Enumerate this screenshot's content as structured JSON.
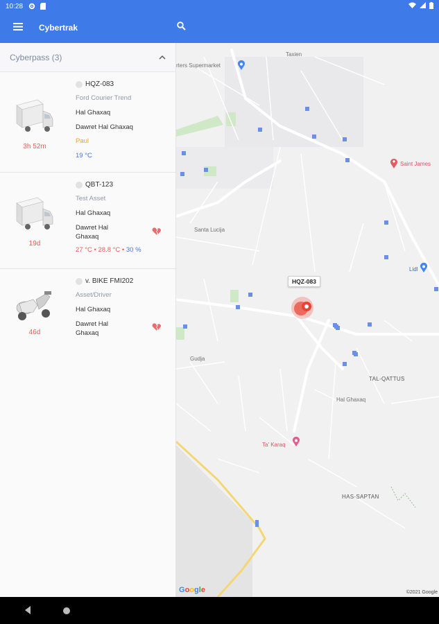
{
  "status_bar": {
    "time": "10:28",
    "icons": [
      "gear-icon",
      "sd-card-icon",
      "wifi-icon",
      "signal-icon",
      "battery-icon"
    ]
  },
  "app_bar": {
    "title": "Cybertrak",
    "menu_icon": "hamburger-icon",
    "search_icon": "search-icon",
    "color": "#3f7be8"
  },
  "group": {
    "title": "Cyberpass (3)",
    "chevron": "chevron-up-icon"
  },
  "assets": [
    {
      "name": "HQZ-083",
      "model": "Ford Courier Trend",
      "location": "Hal Ghaxaq",
      "street": "Dawret Hal Ghaxaq",
      "driver": "Paul",
      "temp": "19 °C",
      "duration": "3h 52m",
      "icon": "truck-icon"
    },
    {
      "name": "QBT-123",
      "model": "Test Asset",
      "location": "Hal Ghaxaq",
      "street": "Dawret Hal Ghaxaq",
      "temp1": "27 °C",
      "temp2": "28.8 °C",
      "humidity": "30 %",
      "separator": "•",
      "duration": "19d",
      "icon": "truck-icon",
      "status_icon": "broken-heart-icon"
    },
    {
      "name": "v. BIKE FMI202",
      "model": "Asset/Driver",
      "location": "Hal Ghaxaq",
      "street": "Dawret Hal Ghaxaq",
      "duration": "46d",
      "icon": "scooter-icon",
      "status_icon": "broken-heart-icon"
    }
  ],
  "map": {
    "labels": {
      "supermarket": "rters Supermarket",
      "taxien": "Taxien",
      "saint_james": "Saint James",
      "santa_lucija": "Santa Lucija",
      "lidl": "Lidl",
      "gudja": "Gudja",
      "tal_qattus": "TAL-QATTUS",
      "hal_ghaxaq": "Hal Ghaxaq",
      "ta_karaq": "Ta' Karaq",
      "has_saptan": "HAS-SAPTAN"
    },
    "vehicle_tag": "HQZ-083",
    "google": "Google",
    "copyright": "©2021 Google"
  },
  "nav_bar": {
    "back_icon": "back-triangle-icon",
    "home_icon": "home-circle-icon"
  }
}
